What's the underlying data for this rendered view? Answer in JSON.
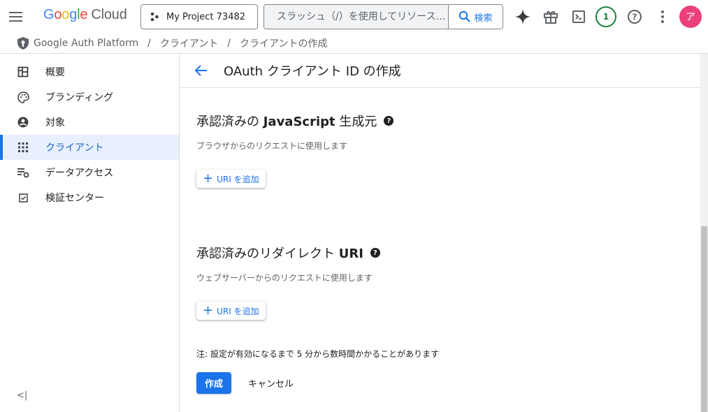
{
  "topbar": {
    "menu_icon": "hamburger-menu-icon",
    "logo": {
      "google": "Google",
      "cloud": "Cloud"
    },
    "project_name": "My Project 73482",
    "search_placeholder": "スラッシュ（/）を使用してリソース…",
    "search_button": "検索",
    "notification_count": "1",
    "avatar_letter": "ア"
  },
  "breadcrumb": {
    "items": [
      "Google Auth Platform",
      "クライアント",
      "クライアントの作成"
    ],
    "separator": "/"
  },
  "sidebar": {
    "items": [
      {
        "label": "概要",
        "icon": "dashboard-icon"
      },
      {
        "label": "ブランディング",
        "icon": "palette-icon"
      },
      {
        "label": "対象",
        "icon": "account-circle-icon"
      },
      {
        "label": "クライアント",
        "icon": "apps-grid-icon"
      },
      {
        "label": "データアクセス",
        "icon": "data-settings-icon"
      },
      {
        "label": "検証センター",
        "icon": "checkbox-icon"
      }
    ],
    "collapse_label": "<|"
  },
  "main": {
    "page_title": "OAuth クライアント ID の作成",
    "js_section": {
      "title_prefix": "承認済みの ",
      "title_bold": "JavaScript",
      "title_suffix": " 生成元",
      "description": "ブラウザからのリクエストに使用します",
      "add_button": "URI を追加"
    },
    "redirect_section": {
      "title_prefix": "承認済みのリダイレクト ",
      "title_bold": "URI",
      "description": "ウェブサーバーからのリクエストに使用します",
      "add_button": "URI を追加"
    },
    "note": "注: 設定が有効になるまで 5 分から数時間かかることがあります",
    "create_button": "作成",
    "cancel_button": "キャンセル"
  },
  "colors": {
    "accent": "#1a73e8",
    "active_bg": "#e8f0fe",
    "avatar": "#ec407a",
    "badge": "#188038"
  }
}
